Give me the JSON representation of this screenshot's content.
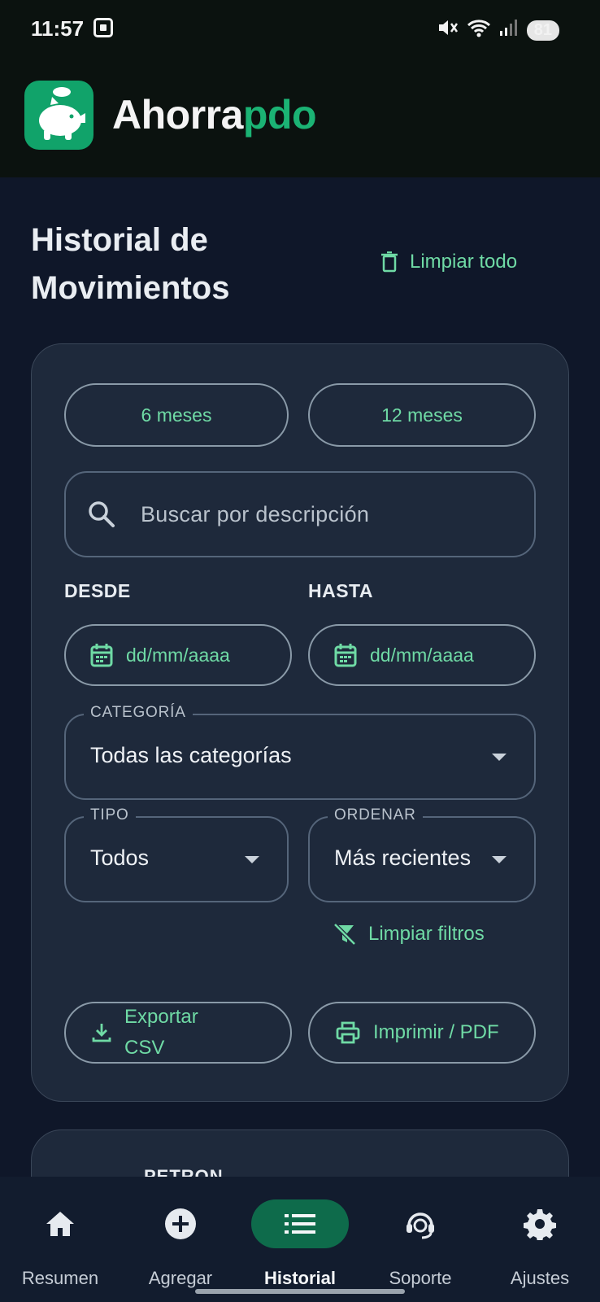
{
  "status_bar": {
    "time": "11:57",
    "battery": "81"
  },
  "app": {
    "name_part1": "Ahorra",
    "name_part2": "pdo"
  },
  "page": {
    "title": "Historial de Movimientos",
    "clear_all_label": "Limpiar todo"
  },
  "filters": {
    "range_6": "6 meses",
    "range_12": "12 meses",
    "search_placeholder": "Buscar por descripción",
    "from_label": "DESDE",
    "to_label": "HASTA",
    "from_value": "dd/mm/aaaa",
    "to_value": "dd/mm/aaaa",
    "category_label": "CATEGORÍA",
    "category_value": "Todas las categorías",
    "type_label": "TIPO",
    "type_value": "Todos",
    "sort_label": "ORDENAR",
    "sort_value": "Más recientes",
    "clear_filters_label": "Limpiar filtros",
    "export_csv_label": "Exportar CSV",
    "print_pdf_label": "Imprimir / PDF"
  },
  "list_peek": {
    "first_item_title": "PETRON"
  },
  "nav": {
    "items": [
      {
        "label": "Resumen"
      },
      {
        "label": "Agregar"
      },
      {
        "label": "Historial"
      },
      {
        "label": "Soporte"
      },
      {
        "label": "Ajustes"
      }
    ],
    "active": "Historial"
  },
  "colors": {
    "accent": "#6fdaa5",
    "brand": "#1bb374",
    "background": "#0f1729",
    "card": "#1e293b",
    "nav_active": "#0e6b4b"
  }
}
